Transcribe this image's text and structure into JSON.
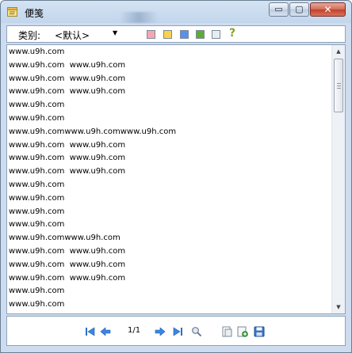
{
  "window": {
    "title": "便笺",
    "buttons": {
      "minimize": "▭",
      "maximize": "▢",
      "close": "✕"
    }
  },
  "toolbar": {
    "category_label": "类别:",
    "category_value": "<默认>",
    "category_arrow": "▼",
    "colors": [
      {
        "name": "pink",
        "hex": "#f2a7b3"
      },
      {
        "name": "yellow",
        "hex": "#f7d24d"
      },
      {
        "name": "blue",
        "hex": "#5a8ff0"
      },
      {
        "name": "green",
        "hex": "#5daa3a"
      },
      {
        "name": "white",
        "hex": "#e6edf5"
      }
    ],
    "help": "?"
  },
  "editor": {
    "lines": [
      "www.u9h.com",
      "www.u9h.com  www.u9h.com",
      "www.u9h.com  www.u9h.com",
      "www.u9h.com  www.u9h.com",
      "www.u9h.com",
      "www.u9h.com",
      "www.u9h.comwww.u9h.comwww.u9h.com",
      "www.u9h.com  www.u9h.com",
      "www.u9h.com  www.u9h.com",
      "www.u9h.com  www.u9h.com",
      "www.u9h.com",
      "www.u9h.com",
      "www.u9h.com",
      "www.u9h.com",
      "www.u9h.comwww.u9h.com",
      "www.u9h.com  www.u9h.com",
      "www.u9h.com  www.u9h.com",
      "www.u9h.com  www.u9h.com",
      "www.u9h.com",
      "www.u9h.com"
    ]
  },
  "bottom": {
    "page_indicator": "1/1"
  }
}
